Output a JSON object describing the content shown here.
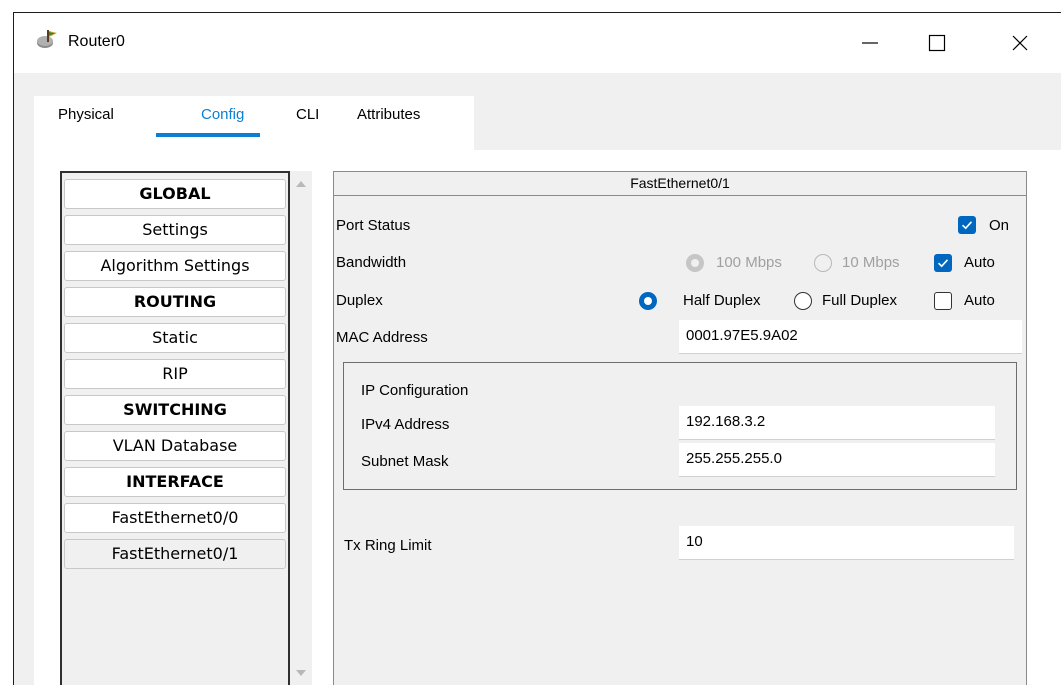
{
  "window": {
    "title": "Router0"
  },
  "tabs": [
    {
      "label": "Physical"
    },
    {
      "label": "Config"
    },
    {
      "label": "CLI"
    },
    {
      "label": "Attributes"
    }
  ],
  "nav": {
    "items": [
      {
        "label": "GLOBAL"
      },
      {
        "label": "Settings"
      },
      {
        "label": "Algorithm Settings"
      },
      {
        "label": "ROUTING"
      },
      {
        "label": "Static"
      },
      {
        "label": "RIP"
      },
      {
        "label": "SWITCHING"
      },
      {
        "label": "VLAN Database"
      },
      {
        "label": "INTERFACE"
      },
      {
        "label": "FastEthernet0/0"
      },
      {
        "label": "FastEthernet0/1"
      }
    ]
  },
  "panel": {
    "title": "FastEthernet0/1",
    "port_status": {
      "label": "Port Status",
      "checkbox_label": "On",
      "checked": true
    },
    "bandwidth": {
      "label": "Bandwidth",
      "opt1": "100 Mbps",
      "opt2": "10 Mbps",
      "auto_label": "Auto",
      "auto_checked": true
    },
    "duplex": {
      "label": "Duplex",
      "opt1": "Half Duplex",
      "opt2": "Full Duplex",
      "auto_label": "Auto",
      "selected": "Half Duplex",
      "auto_checked": false
    },
    "mac": {
      "label": "MAC Address",
      "value": "0001.97E5.9A02"
    },
    "ip_config": {
      "title": "IP Configuration",
      "ipv4": {
        "label": "IPv4 Address",
        "value": "192.168.3.2"
      },
      "mask": {
        "label": "Subnet Mask",
        "value": "255.255.255.0"
      }
    },
    "tx_ring": {
      "label": "Tx Ring Limit",
      "value": "10"
    }
  },
  "colors": {
    "accent": "#0b7fd4",
    "check_blue": "#0067c0"
  }
}
